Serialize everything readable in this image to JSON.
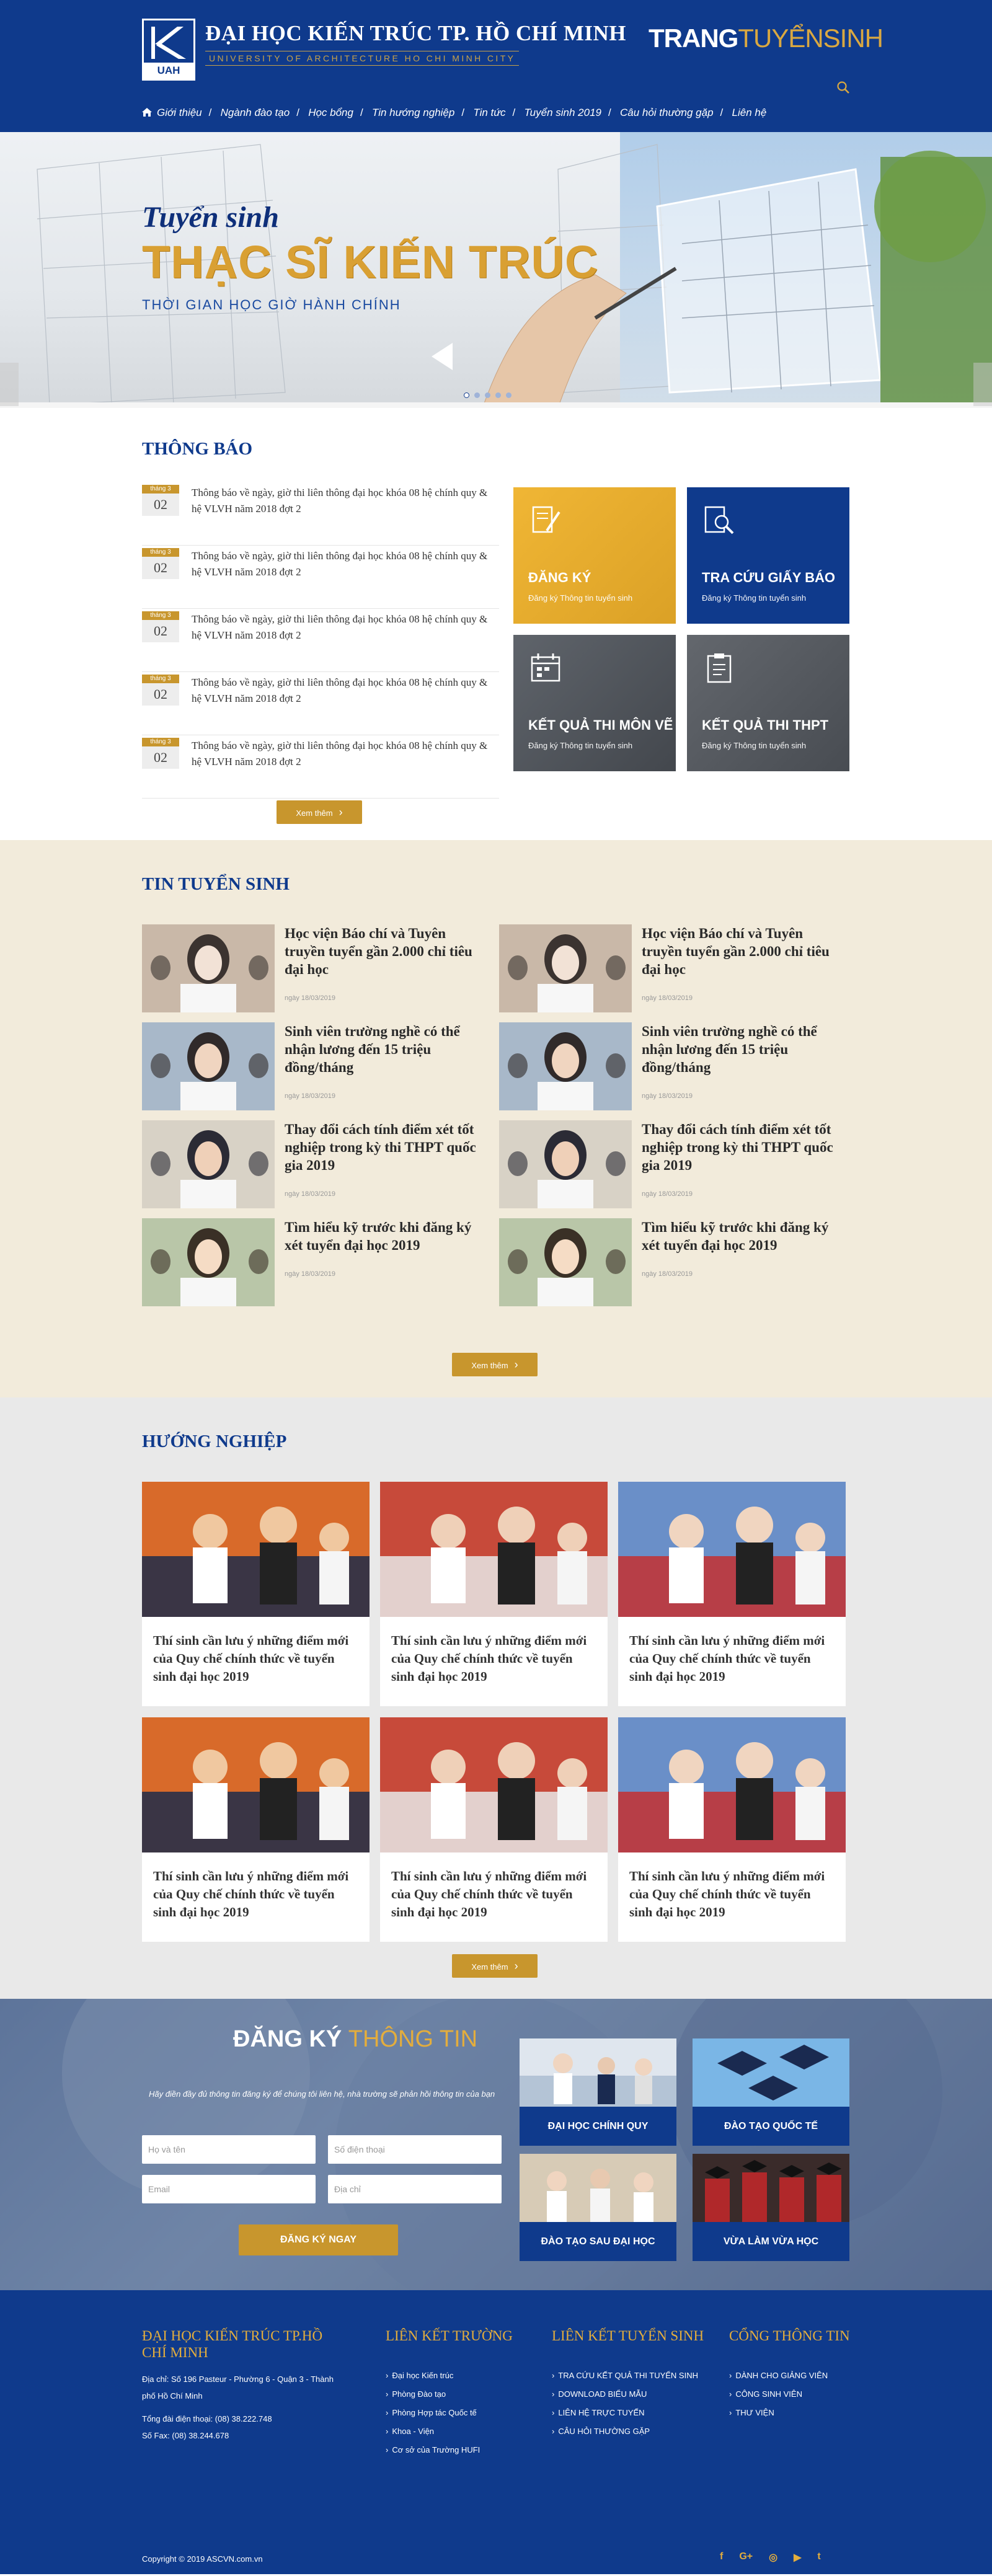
{
  "header": {
    "logo_badge": "UAH",
    "school_name": "ĐẠI HỌC KIẾN TRÚC TP. HỒ CHÍ MINH",
    "school_name_en": "UNIVERSITY OF ARCHITECTURE HO CHI MINH CITY",
    "portal_brand_a": "TRANG",
    "portal_brand_b": "TUYỂNSINH",
    "nav": [
      "Giới thiệu",
      "Ngành đào tạo",
      "Học bổng",
      "Tin hướng nghiệp",
      "Tin tức",
      "Tuyển sinh 2019",
      "Câu hỏi thường gặp",
      "Liên hệ"
    ]
  },
  "banner": {
    "line1": "Tuyển sinh",
    "line2": "THẠC SĨ KIẾN TRÚC",
    "line3": "THỜI GIAN HỌC GIỜ HÀNH CHÍNH"
  },
  "thongbao": {
    "title": "THÔNG BÁO",
    "items": [
      {
        "month": "tháng 3",
        "day": "02",
        "text": "Thông báo về ngày, giờ thi liên thông đại học khóa 08 hệ chính quy & hệ VLVH năm 2018 đợt 2"
      },
      {
        "month": "tháng 3",
        "day": "02",
        "text": "Thông báo về ngày, giờ thi liên thông đại học khóa 08 hệ chính quy & hệ VLVH năm 2018 đợt 2"
      },
      {
        "month": "tháng 3",
        "day": "02",
        "text": "Thông báo về ngày, giờ thi liên thông đại học khóa 08 hệ chính quy & hệ VLVH năm 2018 đợt 2"
      },
      {
        "month": "tháng 3",
        "day": "02",
        "text": "Thông báo về ngày, giờ thi liên thông đại học khóa 08 hệ chính quy & hệ VLVH năm 2018 đợt 2"
      },
      {
        "month": "tháng 3",
        "day": "02",
        "text": "Thông báo về ngày, giờ thi liên thông đại học khóa 08 hệ chính quy & hệ VLVH năm 2018 đợt 2"
      }
    ],
    "more_label": "Xem thêm",
    "cards": [
      {
        "title": "ĐĂNG KÝ",
        "sub": "Đăng ký Thông tin tuyển sinh",
        "color": "#e5a92c",
        "icon": "pencil-paper-icon"
      },
      {
        "title": "TRA CỨU GIẤY BÁO",
        "sub": "Đăng ký Thông tin tuyển sinh",
        "color": "#0f3a8c",
        "icon": "search-document-icon"
      },
      {
        "title": "KẾT QUẢ THI MÔN VẼ",
        "sub": "Đăng ký Thông tin tuyển sinh",
        "color": "#555a62",
        "icon": "calendar-icon"
      },
      {
        "title": "KẾT QUẢ THI THPT",
        "sub": "Đăng ký Thông tin tuyển sinh",
        "color": "#5a5e64",
        "icon": "clipboard-icon"
      }
    ]
  },
  "tintuyensinh": {
    "title": "TIN TUYỂN SINH",
    "items": [
      {
        "title": "Học viện Báo chí và Tuyên truyền tuyển gần 2.000 chỉ tiêu đại học",
        "date": "ngày 18/03/2019"
      },
      {
        "title": "Học viện Báo chí và Tuyên truyền tuyển gần 2.000 chỉ tiêu đại học",
        "date": "ngày 18/03/2019"
      },
      {
        "title": "Sinh viên trường nghề có thể nhận lương đến 15 triệu đồng/tháng",
        "date": "ngày 18/03/2019"
      },
      {
        "title": "Sinh viên trường nghề có thể nhận lương đến 15 triệu đồng/tháng",
        "date": "ngày 18/03/2019"
      },
      {
        "title": "Thay đổi cách tính điểm xét tốt nghiệp trong kỳ thi THPT quốc gia 2019",
        "date": "ngày 18/03/2019"
      },
      {
        "title": "Thay đổi cách tính điểm xét tốt nghiệp trong kỳ thi THPT quốc gia 2019",
        "date": "ngày 18/03/2019"
      },
      {
        "title": "Tìm hiểu kỹ trước khi đăng ký xét tuyển đại học 2019",
        "date": "ngày 18/03/2019"
      },
      {
        "title": "Tìm hiểu kỹ trước khi đăng ký xét tuyển đại học 2019",
        "date": "ngày 18/03/2019"
      }
    ],
    "more_label": "Xem thêm"
  },
  "huongnghiep": {
    "title": "HƯỚNG NGHIỆP",
    "items": [
      "Thí sinh cần lưu ý những điểm mới của Quy chế chính thức về tuyển sinh đại học 2019",
      "Thí sinh cần lưu ý những điểm mới của Quy chế chính thức về tuyển sinh đại học 2019",
      "Thí sinh cần lưu ý những điểm mới của Quy chế chính thức về tuyển sinh đại học 2019",
      "Thí sinh cần lưu ý những điểm mới của Quy chế chính thức về tuyển sinh đại học 2019",
      "Thí sinh cần lưu ý những điểm mới của Quy chế chính thức về tuyển sinh đại học 2019",
      "Thí sinh cần lưu ý những điểm mới của Quy chế chính thức về tuyển sinh đại học 2019"
    ],
    "more_label": "Xem thêm"
  },
  "dangky": {
    "title_a": "ĐĂNG KÝ",
    "title_b": "THÔNG TIN",
    "desc": "Hãy điền đầy đủ thông tin đăng ký để chúng tôi liên hệ, nhà trường sẽ phản hồi thông tin của bạn",
    "placeholders": {
      "name": "Họ và tên",
      "phone": "Số điện thoại",
      "email": "Email",
      "address": "Địa chỉ"
    },
    "submit": "ĐĂNG KÝ NGAY",
    "programs": [
      "ĐẠI HỌC CHÍNH QUY",
      "ĐÀO TẠO  QUỐC TẾ",
      "ĐÀO TẠO SAU ĐẠI HỌC",
      "VỪA LÀM VỪA HỌC"
    ]
  },
  "footer": {
    "col1_title": "ĐẠI HỌC KIẾN TRÚC TP.HỒ CHÍ MINH",
    "address": "Địa chỉ: Số 196 Pasteur - Phường 6 - Quận 3 - Thành phố Hồ Chí Minh",
    "phone": "Tổng đài điện thoại: (08) 38.222.748",
    "fax": "Số Fax: (08) 38.244.678",
    "col2_title": "LIÊN KẾT TRƯỜNG",
    "col2_items": [
      "Đại học Kiến trúc",
      "Phòng Đào tạo",
      "Phòng Hợp tác Quốc tế",
      "Khoa - Viện",
      "Cơ sở của Trường HUFI"
    ],
    "col3_title": "LIÊN KẾT TUYỂN SINH",
    "col3_items": [
      "TRA CỨU KẾT QUẢ THI TUYỂN SINH",
      "DOWNLOAD BIỂU MẪU",
      "LIÊN HỆ TRỰC TUYẾN",
      "CÂU HỎI THƯỜNG GẶP"
    ],
    "col4_title": "CỔNG THÔNG TIN",
    "col4_items": [
      "DÀNH CHO GIẢNG VIÊN",
      "CÔNG SINH VIÊN",
      "THƯ VIỆN"
    ],
    "copyright": "Copyright © 2019 ASCVN.com.vn",
    "social": [
      "f",
      "G+",
      "◎",
      "▶",
      "t"
    ]
  }
}
